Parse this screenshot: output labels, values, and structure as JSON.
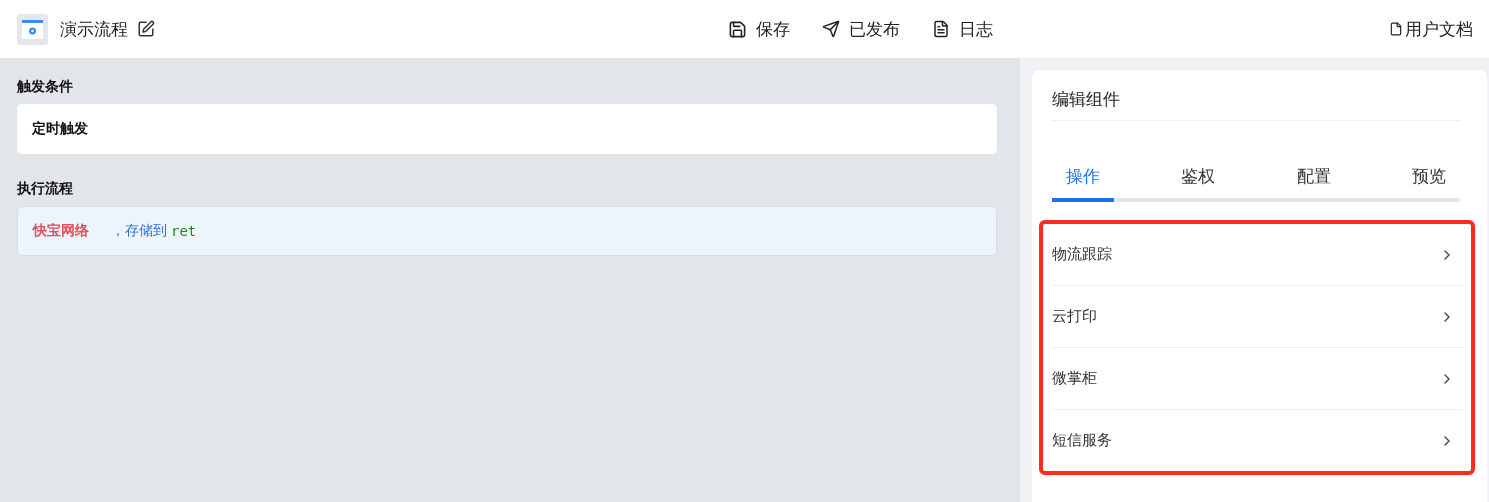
{
  "header": {
    "title": "演示流程",
    "actions": [
      {
        "kind": "save",
        "label": "保存"
      },
      {
        "kind": "publish",
        "label": "已发布"
      },
      {
        "kind": "log",
        "label": "日志"
      }
    ],
    "docs": "用户文档"
  },
  "trigger": {
    "heading": "触发条件",
    "value": "定时触发"
  },
  "flow": {
    "heading": "执行流程",
    "service": "快宝网络",
    "separator": "，存储到",
    "variable": "ret"
  },
  "panel": {
    "title": "编辑组件",
    "tabs": [
      {
        "label": "操作",
        "selected": true
      },
      {
        "label": "鉴权",
        "selected": false
      },
      {
        "label": "配置",
        "selected": false
      },
      {
        "label": "预览",
        "selected": false
      }
    ],
    "items": [
      "物流跟踪",
      "云打印",
      "微掌柜",
      "短信服务"
    ]
  }
}
